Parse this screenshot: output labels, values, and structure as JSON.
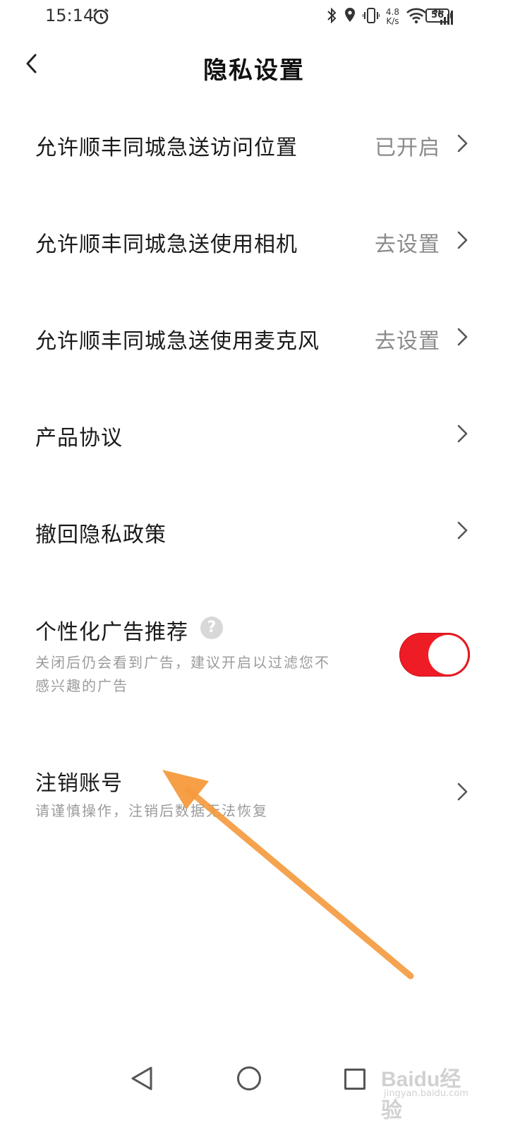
{
  "status_bar": {
    "time": "15:14",
    "net_speed_value": "4.8",
    "net_speed_unit": "K/s",
    "signal_type": "5G",
    "battery": "56",
    "icons": [
      "alarm-icon",
      "bluetooth-icon",
      "location-icon",
      "vibrate-icon",
      "wifi-icon",
      "cellular-signal-icon",
      "battery-icon"
    ]
  },
  "header": {
    "back_icon": "chevron-left-icon",
    "title": "隐私设置"
  },
  "settings": {
    "location": {
      "label": "允许顺丰同城急送访问位置",
      "value": "已开启"
    },
    "camera": {
      "label": "允许顺丰同城急送使用相机",
      "value": "去设置"
    },
    "microphone": {
      "label": "允许顺丰同城急送使用麦克风",
      "value": "去设置"
    },
    "agreement": {
      "label": "产品协议"
    },
    "revoke": {
      "label": "撤回隐私政策"
    },
    "ads": {
      "label": "个性化广告推荐",
      "help_icon": "?",
      "desc_line1": "关闭后仍会看到广告，建议开启以过滤您不",
      "desc_line2": "感兴趣的广告",
      "toggle_on": true
    },
    "cancel_account": {
      "label": "注销账号",
      "desc": "请谨慎操作，注销后数据无法恢复"
    }
  },
  "annotation": {
    "arrow_color": "#f59a3c"
  },
  "nav_bar": {
    "icons": [
      "nav-back-icon",
      "nav-home-icon",
      "nav-recent-icon"
    ]
  },
  "watermark": {
    "main": "Baidu经验",
    "sub": "jingyan.baidu.com"
  },
  "colors": {
    "toggle_on": "#ee1c25",
    "secondary_text": "#8a8a8a"
  }
}
